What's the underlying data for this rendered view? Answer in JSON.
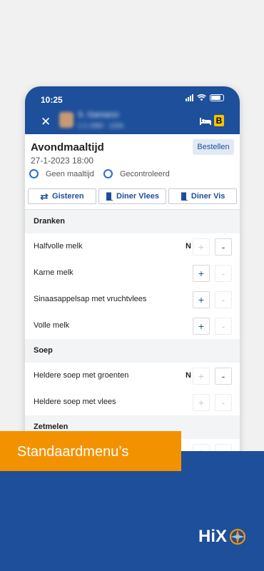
{
  "status": {
    "time": "10:25"
  },
  "patient": {
    "name": "S. Gamanci",
    "sub": "1-1-1960 · 1234"
  },
  "header": {
    "ward_badge": "B"
  },
  "meal": {
    "title": "Avondmaaltijd",
    "datetime": "27-1-2023 18:00",
    "order_label": "Bestellen",
    "options": [
      "Geen maaltijd",
      "Gecontroleerd"
    ]
  },
  "tabs": [
    {
      "label": "Gisteren",
      "icon": "repeat-icon"
    },
    {
      "label": "Diner Vlees",
      "icon": "door-icon"
    },
    {
      "label": "Diner Vis",
      "icon": "door-icon"
    }
  ],
  "sections": [
    {
      "title": "Dranken",
      "items": [
        {
          "label": "Halfvolle melk",
          "count": "N",
          "plus_enabled": false,
          "minus_enabled": true
        },
        {
          "label": "Karne melk",
          "count": "",
          "plus_enabled": true,
          "minus_enabled": false
        },
        {
          "label": "Sinaasappelsap met vruchtvlees",
          "count": "",
          "plus_enabled": true,
          "minus_enabled": false
        },
        {
          "label": "Volle melk",
          "count": "",
          "plus_enabled": true,
          "minus_enabled": false
        }
      ]
    },
    {
      "title": "Soep",
      "items": [
        {
          "label": "Heldere soep met groenten",
          "count": "N",
          "plus_enabled": false,
          "minus_enabled": true
        },
        {
          "label": "Heldere soep met vlees",
          "count": "",
          "plus_enabled": false,
          "minus_enabled": false
        }
      ]
    },
    {
      "title": "Zetmelen",
      "items": [
        {
          "label": "",
          "count": "",
          "plus_enabled": false,
          "minus_enabled": false
        }
      ]
    }
  ],
  "banner": {
    "text": "Standaardmenu’s",
    "brand": "HiX"
  },
  "colors": {
    "primary": "#1d4f9a",
    "accent": "#f39200"
  }
}
